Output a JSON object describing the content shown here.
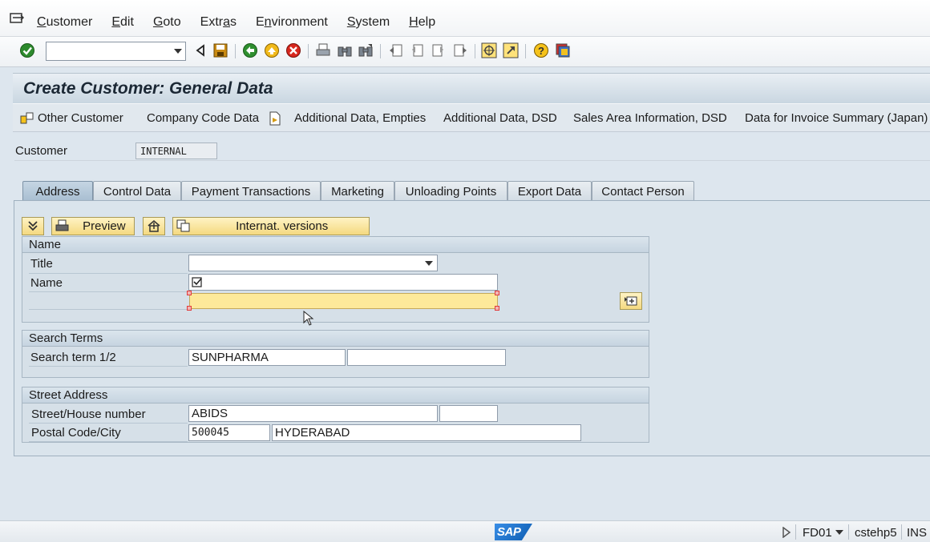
{
  "menu": {
    "items": [
      {
        "label": "Customer",
        "u": "C",
        "rest": "ustomer"
      },
      {
        "label": "Edit",
        "u": "E",
        "rest": "dit"
      },
      {
        "label": "Goto",
        "u": "G",
        "rest": "oto"
      },
      {
        "label": "Extras",
        "pre": "Extr",
        "u": "a",
        "rest": "s"
      },
      {
        "label": "Environment",
        "pre": "E",
        "u": "n",
        "rest": "vironment"
      },
      {
        "label": "System",
        "u": "S",
        "rest": "ystem"
      },
      {
        "label": "Help",
        "u": "H",
        "rest": "elp"
      }
    ]
  },
  "toolbar": {
    "command_value": ""
  },
  "title": "Create Customer: General Data",
  "app_toolbar": {
    "other_customer": "Other Customer",
    "company_code": "Company Code Data",
    "additional_empties": "Additional Data, Empties",
    "additional_dsd": "Additional Data, DSD",
    "sales_area_dsd": "Sales Area Information, DSD",
    "invoice_summary": "Data for Invoice Summary (Japan)"
  },
  "customer": {
    "label": "Customer",
    "value": "INTERNAL"
  },
  "tabs": [
    "Address",
    "Control Data",
    "Payment Transactions",
    "Marketing",
    "Unloading Points",
    "Export Data",
    "Contact Person"
  ],
  "section_toolbar": {
    "preview": "Preview",
    "internat": "Internat. versions"
  },
  "name_group": {
    "header": "Name",
    "title_label": "Title",
    "title_value": "",
    "name_label": "Name",
    "name1_value": "",
    "name2_value": ""
  },
  "search_group": {
    "header": "Search Terms",
    "label": "Search term 1/2",
    "term1": "SUNPHARMA",
    "term2": ""
  },
  "street_group": {
    "header": "Street Address",
    "street_label": "Street/House number",
    "street_value": "ABIDS",
    "house_value": "",
    "postal_label": "Postal Code/City",
    "postal_value": "500045",
    "city_value": "HYDERABAD"
  },
  "status": {
    "transaction": "FD01",
    "server": "cstehp5",
    "mode": "INS",
    "logo": "SAP"
  },
  "colors": {
    "tab_active": "#a9bfd2",
    "focus_field": "#fde99a",
    "button_yellow": "#f4d980"
  }
}
